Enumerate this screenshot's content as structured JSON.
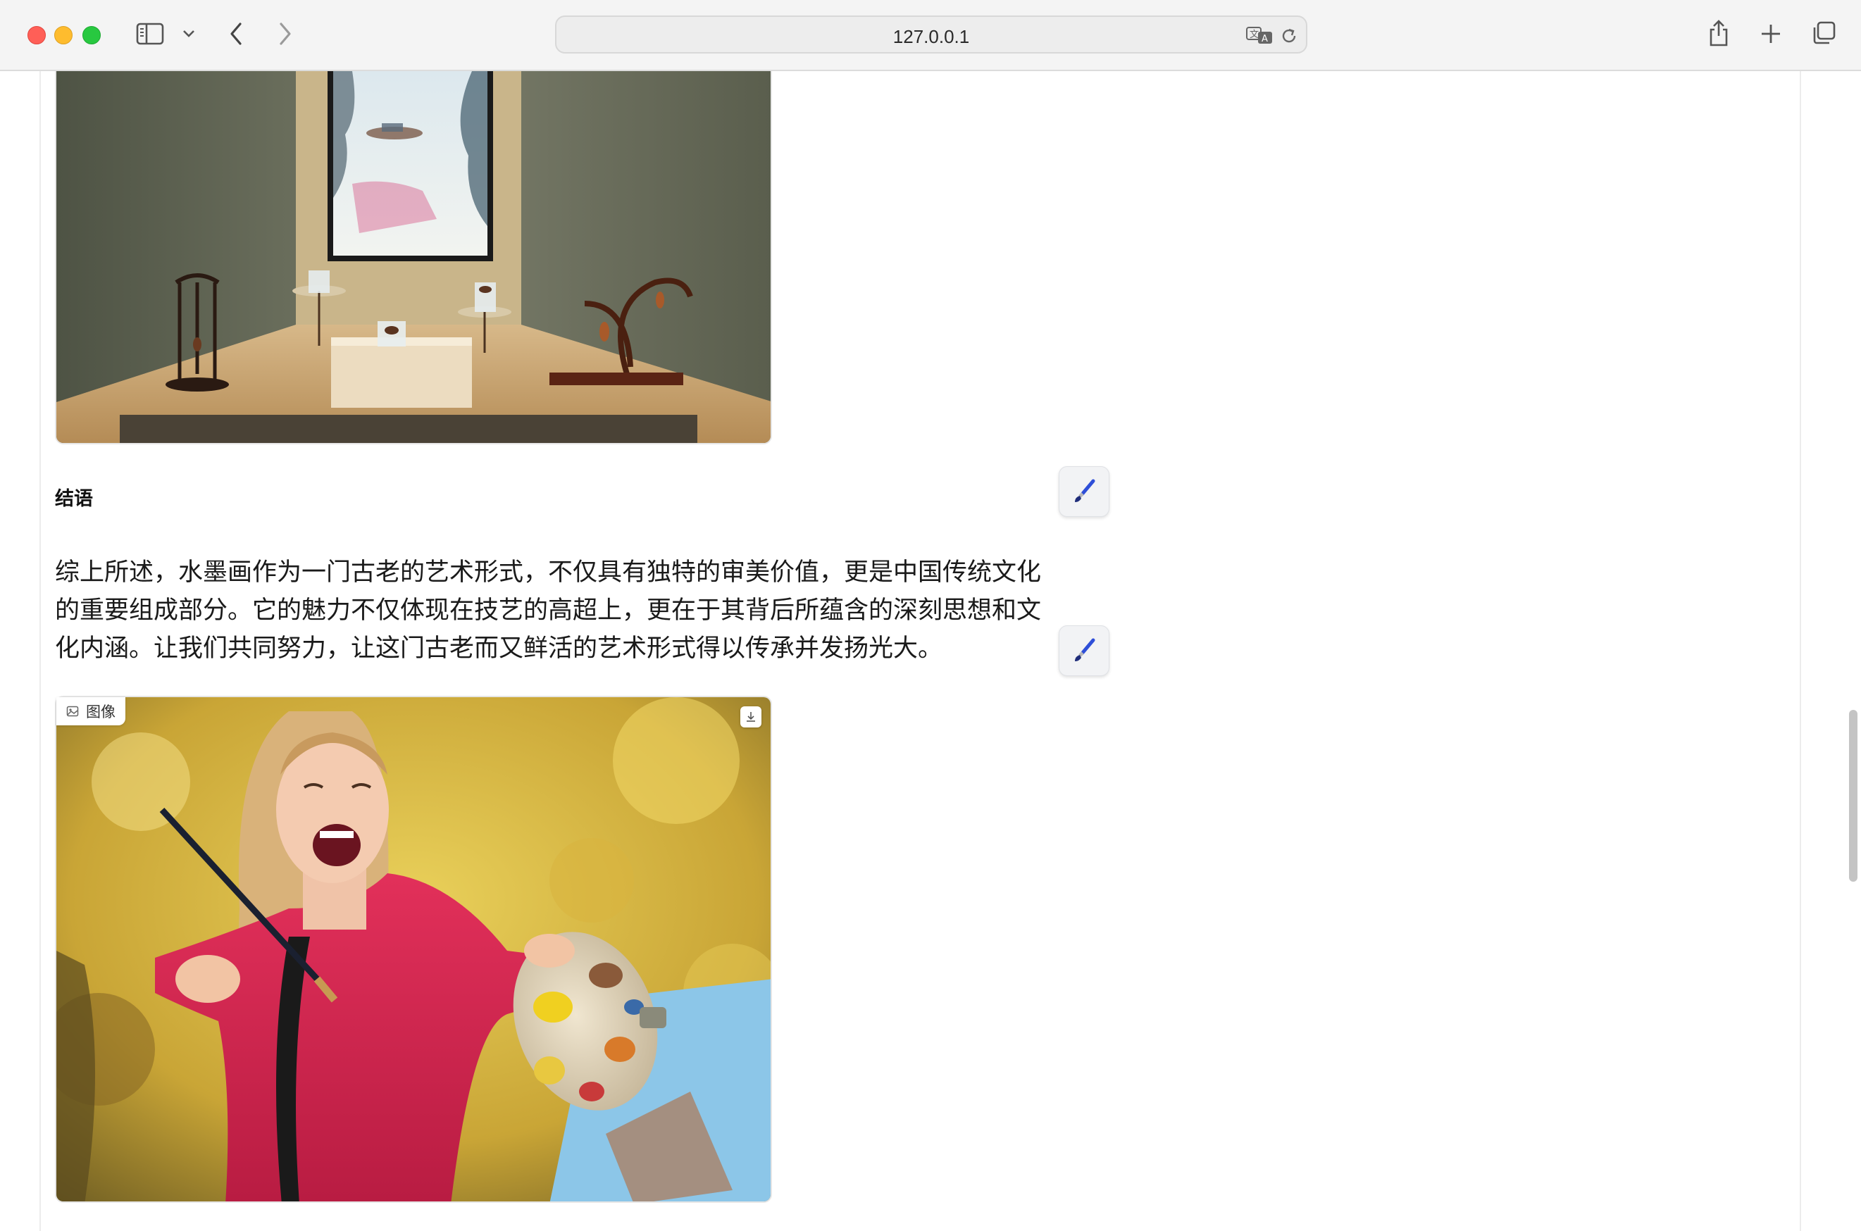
{
  "browser": {
    "url": "127.0.0.1",
    "icons": [
      "sidebar-icon",
      "chevron-down-icon",
      "back-icon",
      "forward-icon",
      "translate-icon",
      "reload-icon",
      "share-icon",
      "new-tab-icon",
      "tabs-overview-icon"
    ]
  },
  "article": {
    "section_title": "结语",
    "paragraph_lines": [
      "综上所述，水墨画作为一门古老的艺术形式，不仅具有独特的审美价值，更是中国传统文化",
      "的重要组成部分。它的魅力不仅体现在技艺的高超上，更在于其背后所蕴含的深刻思想和文",
      "化内涵。让我们共同努力，让这门古老而又鲜活的艺术形式得以传承并发扬光大。"
    ],
    "edit_icon": "paintbrush-icon",
    "image_badge_label": "图像",
    "image_badge_icon": "image-icon",
    "download_icon": "download-icon"
  },
  "colors": {
    "accent_brush": "#2f4fd8",
    "chrome_bg": "#f4f4f4"
  }
}
